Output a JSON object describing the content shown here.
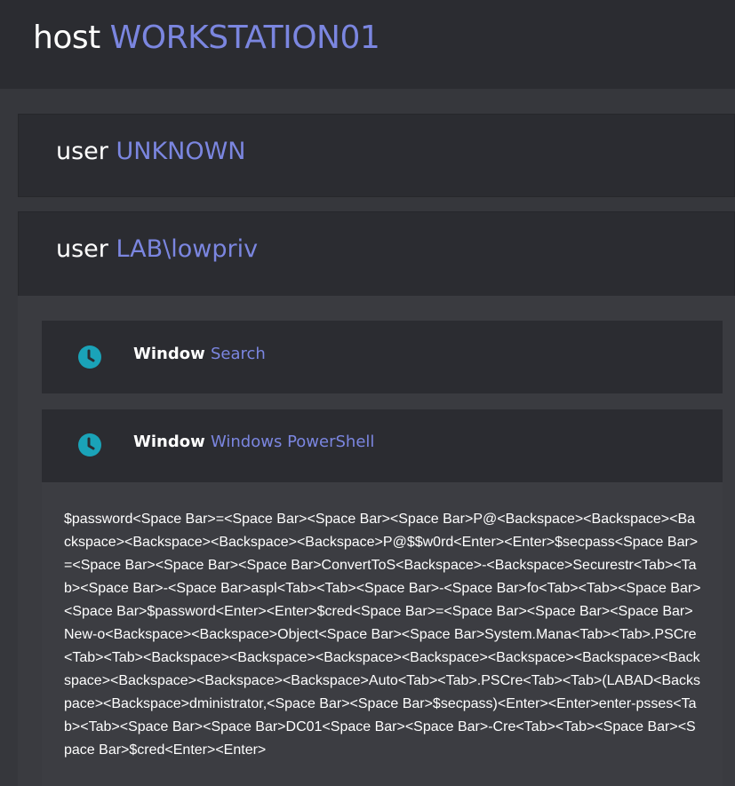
{
  "host": {
    "prefix": "host",
    "name": "WORKSTATION01"
  },
  "users": [
    {
      "prefix": "user",
      "name": "UNKNOWN"
    },
    {
      "prefix": "user",
      "name": "LAB\\lowpriv"
    }
  ],
  "windows": [
    {
      "prefix": "Window",
      "name": "Search",
      "icon": "clock-icon"
    },
    {
      "prefix": "Window",
      "name": "Windows PowerShell",
      "icon": "clock-icon"
    }
  ],
  "keystrokes": "$password<Space Bar>=<Space Bar><Space Bar><Space Bar>P@<Backspace><Backspace><Backspace><Backspace><Backspace><Backspace>P@$$w0rd<Enter><Enter>$secpass<Space Bar>=<Space Bar><Space Bar><Space Bar>ConvertToS<Backspace>-<Backspace>Securestr<Tab><Tab><Space Bar>-<Space Bar>aspl<Tab><Tab><Space Bar>-<Space Bar>fo<Tab><Tab><Space Bar><Space Bar>$password<Enter><Enter>$cred<Space Bar>=<Space Bar><Space Bar><Space Bar>New-o<Backspace><Backspace>Object<Space Bar><Space Bar>System.Mana<Tab><Tab>.PSCre<Tab><Tab><Backspace><Backspace><Backspace><Backspace><Backspace><Backspace><Backspace><Backspace><Backspace><Backspace>Auto<Tab><Tab>.PSCre<Tab><Tab>(LABAD<Backspace><Backspace>dministrator,<Space Bar><Space Bar>$secpass)<Enter><Enter>enter-psses<Tab><Tab><Space Bar><Space Bar>DC01<Space Bar><Space Bar>-Cre<Tab><Tab><Space Bar><Space Bar>$cred<Enter><Enter>",
  "colors": {
    "accent": "#7b86e0",
    "clock": "#1aa3b8",
    "panel": "#2b2c31",
    "background": "#36373c"
  }
}
